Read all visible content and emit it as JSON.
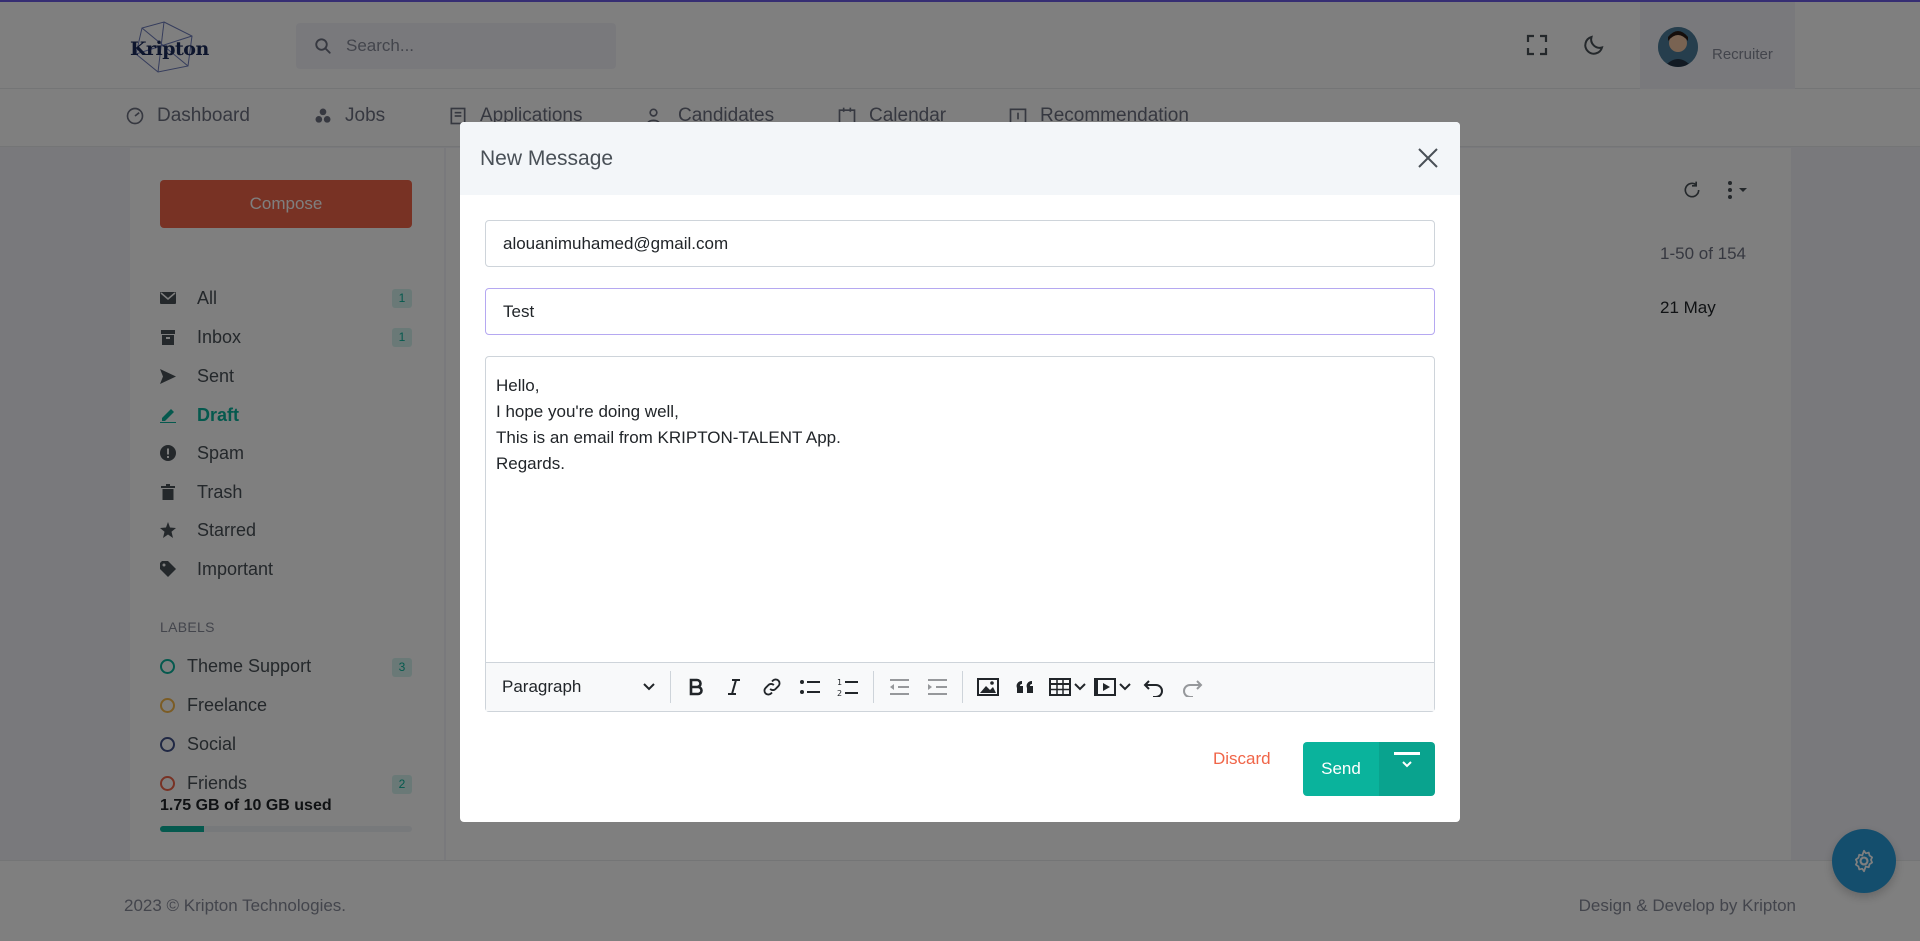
{
  "brand": {
    "name": "Kripton"
  },
  "header": {
    "search_placeholder": "Search...",
    "user_role": "Recruiter"
  },
  "nav": [
    {
      "label": "Dashboard",
      "icon": "dashboard-icon"
    },
    {
      "label": "Jobs",
      "icon": "jobs-icon"
    },
    {
      "label": "Applications",
      "icon": "applications-icon"
    },
    {
      "label": "Candidates",
      "icon": "candidates-icon"
    },
    {
      "label": "Calendar",
      "icon": "calendar-icon"
    },
    {
      "label": "Recommendation",
      "icon": "recommendation-icon"
    }
  ],
  "sidebar": {
    "compose_label": "Compose",
    "items": [
      {
        "label": "All",
        "badge": "1",
        "icon": "mail-icon"
      },
      {
        "label": "Inbox",
        "badge": "1",
        "icon": "inbox-icon"
      },
      {
        "label": "Sent",
        "badge": "",
        "icon": "send-icon"
      },
      {
        "label": "Draft",
        "badge": "",
        "icon": "pen-icon",
        "active": true
      },
      {
        "label": "Spam",
        "badge": "",
        "icon": "spam-icon"
      },
      {
        "label": "Trash",
        "badge": "",
        "icon": "trash-icon"
      },
      {
        "label": "Starred",
        "badge": "",
        "icon": "star-icon"
      },
      {
        "label": "Important",
        "badge": "",
        "icon": "tag-icon"
      }
    ],
    "labels_title": "Labels",
    "labels": [
      {
        "label": "Theme Support",
        "badge": "3",
        "color": "#0ab39c"
      },
      {
        "label": "Freelance",
        "badge": "",
        "color": "#f7b84b"
      },
      {
        "label": "Social",
        "badge": "",
        "color": "#405189"
      },
      {
        "label": "Friends",
        "badge": "2",
        "color": "#f06548"
      }
    ],
    "storage_text": "1.75 GB of 10 GB used",
    "storage_fraction": 0.175
  },
  "main": {
    "pager_text": "1-50 of 154",
    "row_date": "21 May"
  },
  "footer": {
    "copyright": "2023 © Kripton Technologies.",
    "credit": "Design & Develop by Kripton"
  },
  "modal": {
    "title": "New Message",
    "to_value": "alouanimuhamed@gmail.com",
    "subject_value": "Test",
    "body_lines": [
      "Hello,",
      "I hope you're doing well,",
      "This is an email from KRIPTON-TALENT App.",
      "Regards."
    ],
    "format_select": "Paragraph",
    "discard_label": "Discard",
    "send_label": "Send"
  },
  "colors": {
    "accent_green": "#0ab39c",
    "compose_orange": "#f06548",
    "discard_orange": "#f06548",
    "settings_blue": "#299cdb"
  }
}
